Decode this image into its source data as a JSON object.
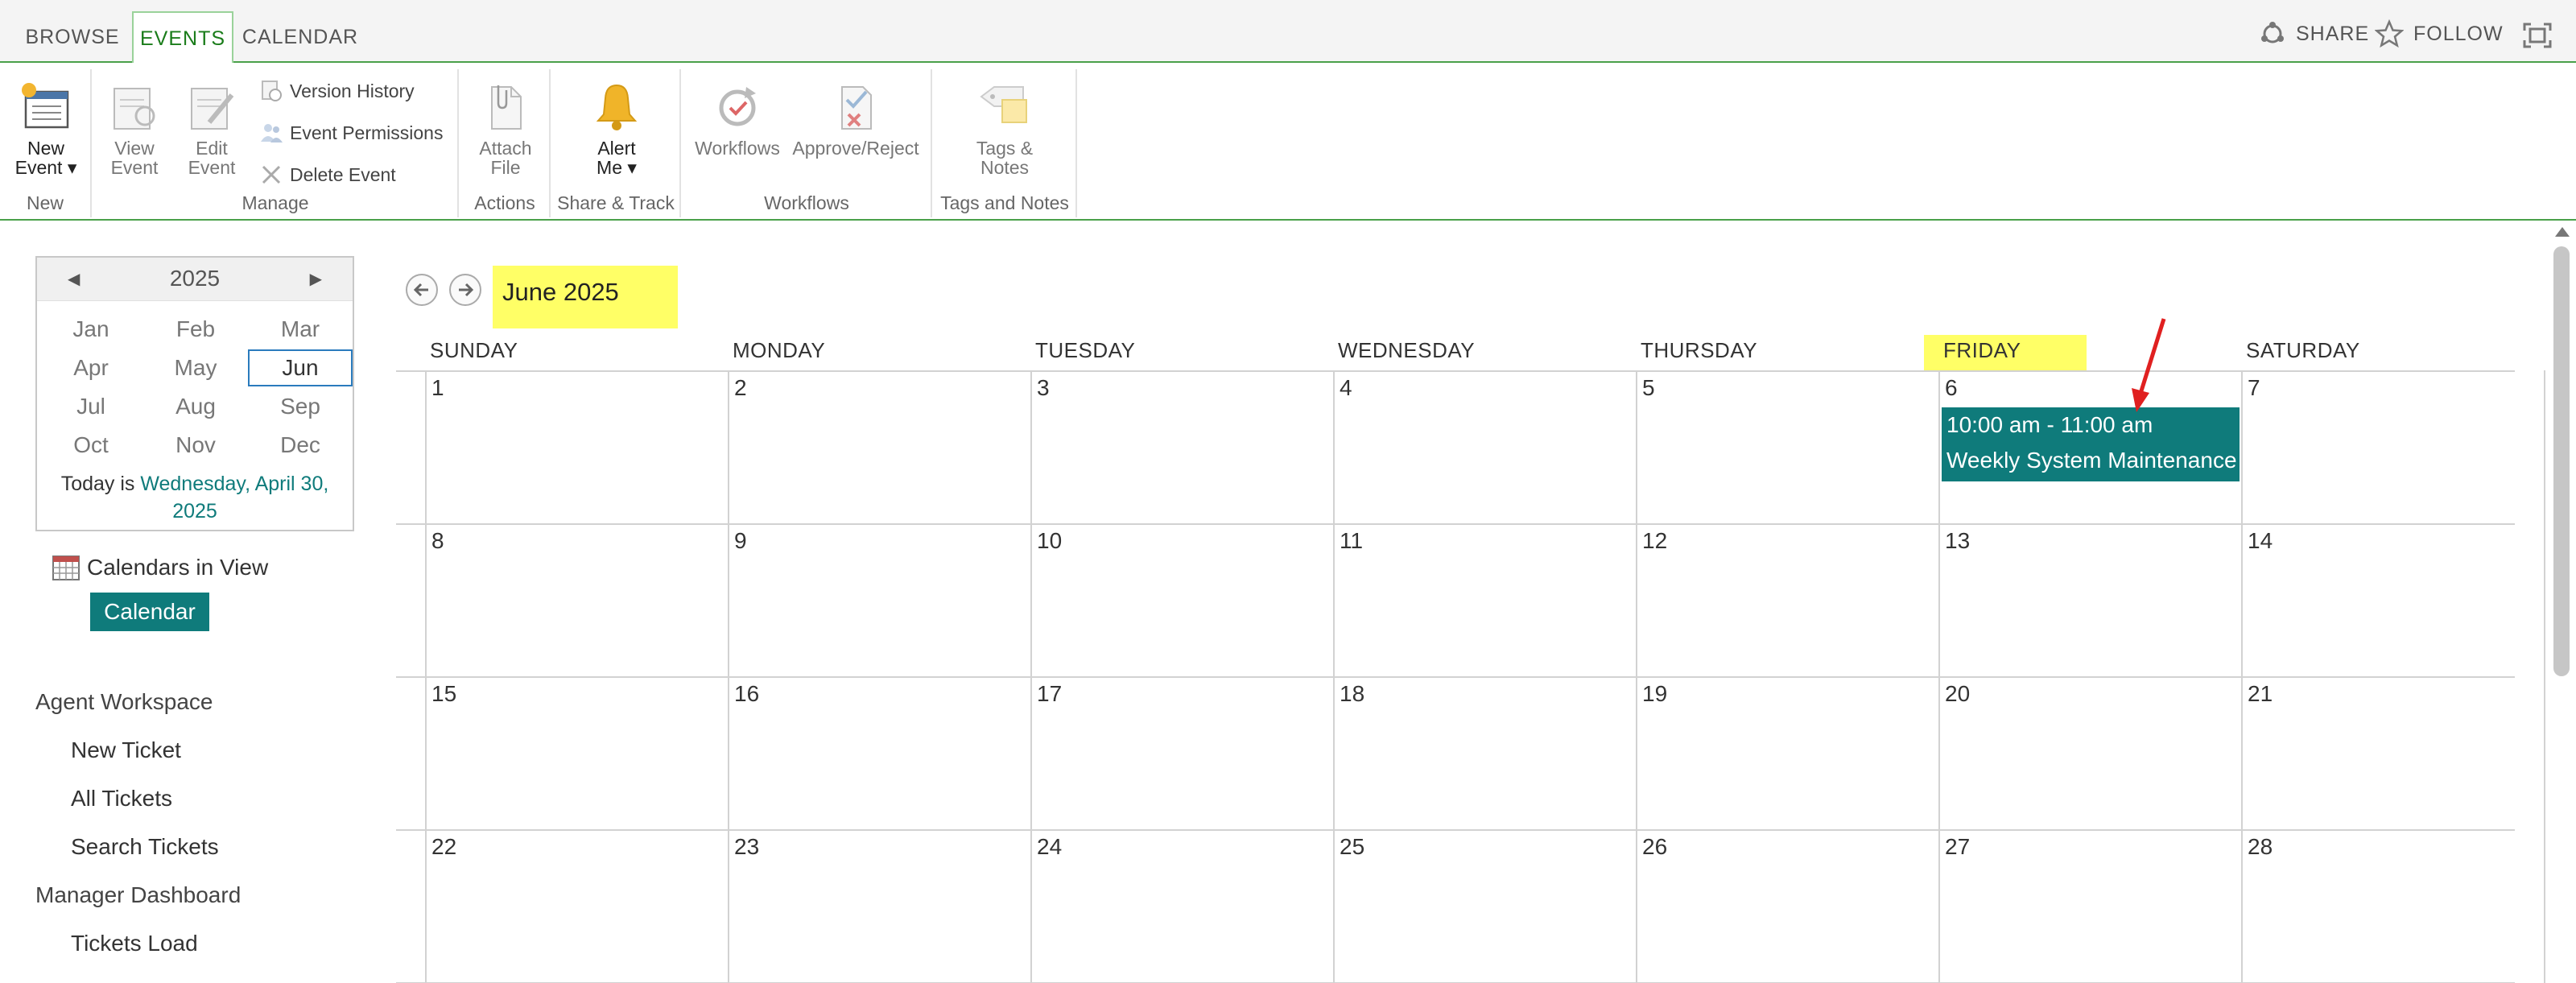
{
  "tabs": [
    {
      "label": "BROWSE",
      "active": false
    },
    {
      "label": "EVENTS",
      "active": true
    },
    {
      "label": "CALENDAR",
      "active": false
    }
  ],
  "top_right": {
    "share": "SHARE",
    "follow": "FOLLOW"
  },
  "ribbon": {
    "new_event_line1": "New",
    "new_event_line2": "Event",
    "group_new": "New",
    "view_event_line1": "View",
    "view_event_line2": "Event",
    "edit_event_line1": "Edit",
    "edit_event_line2": "Event",
    "version_history": "Version History",
    "event_permissions": "Event Permissions",
    "delete_event": "Delete Event",
    "group_manage": "Manage",
    "attach_file_line1": "Attach",
    "attach_file_line2": "File",
    "group_actions": "Actions",
    "alert_me_line1": "Alert",
    "alert_me_line2": "Me",
    "group_share_track": "Share & Track",
    "workflows": "Workflows",
    "approve_reject": "Approve/Reject",
    "group_workflows": "Workflows",
    "tags_notes_line1": "Tags &",
    "tags_notes_line2": "Notes",
    "group_tags_notes": "Tags and Notes"
  },
  "datepicker": {
    "year": "2025",
    "months": [
      "Jan",
      "Feb",
      "Mar",
      "Apr",
      "May",
      "Jun",
      "Jul",
      "Aug",
      "Sep",
      "Oct",
      "Nov",
      "Dec"
    ],
    "selected_month": "Jun",
    "today_prefix": "Today is",
    "today_date_line1": "Wednesday, April 30,",
    "today_date_line2": "2025"
  },
  "calendars_in_view": {
    "title": "Calendars in View",
    "calendar": "Calendar"
  },
  "nav": {
    "agent_workspace": "Agent Workspace",
    "new_ticket": "New Ticket",
    "all_tickets": "All Tickets",
    "search_tickets": "Search Tickets",
    "manager_dashboard": "Manager Dashboard",
    "tickets_load": "Tickets Load"
  },
  "calendar": {
    "month_label": "June 2025",
    "weekdays": [
      "SUNDAY",
      "MONDAY",
      "TUESDAY",
      "WEDNESDAY",
      "THURSDAY",
      "FRIDAY",
      "SATURDAY"
    ],
    "weeks": [
      [
        "1",
        "2",
        "3",
        "4",
        "5",
        "6",
        "7"
      ],
      [
        "8",
        "9",
        "10",
        "11",
        "12",
        "13",
        "14"
      ],
      [
        "15",
        "16",
        "17",
        "18",
        "19",
        "20",
        "21"
      ],
      [
        "22",
        "23",
        "24",
        "25",
        "26",
        "27",
        "28"
      ]
    ],
    "event": {
      "time": "10:00 am - 11:00 am",
      "title": "Weekly System Maintenance"
    }
  },
  "colors": {
    "accent": "#0f7b7b",
    "highlight": "#ffff66",
    "ribbon_line": "#4aa04a",
    "annotation_arrow": "#e02020"
  }
}
